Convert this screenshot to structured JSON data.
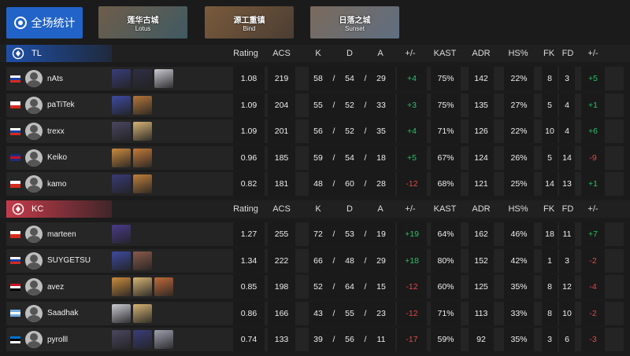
{
  "header": {
    "all_stats_label": "全场统计",
    "maps": [
      {
        "cn": "莲华古城",
        "en": "Lotus",
        "color_a": "#6f5d4a",
        "color_b": "#3f5a63"
      },
      {
        "cn": "源工重镇",
        "en": "Bind",
        "color_a": "#7a5b3c",
        "color_b": "#4b3d33"
      },
      {
        "cn": "日落之城",
        "en": "Sunset",
        "color_a": "#7a6a5c",
        "color_b": "#5f6e82"
      }
    ]
  },
  "columns": [
    "Rating",
    "ACS",
    "K",
    "D",
    "A",
    "+/-",
    "KAST",
    "ADR",
    "HS%",
    "FK",
    "FD",
    "+/-"
  ],
  "teams": [
    {
      "name": "TL",
      "accent": "#1e4fa8",
      "players": [
        {
          "name": "nAts",
          "flag": "ru",
          "agents": [
            "#3a3d7a",
            "#2f2f44",
            "#c9c9d3"
          ],
          "rating": "1.08",
          "acs": "219",
          "k": "58",
          "d": "54",
          "a": "29",
          "pm": "+4",
          "kast": "75%",
          "adr": "142",
          "hs": "22%",
          "fk": "8",
          "fd": "3",
          "fpm": "+5"
        },
        {
          "name": "paTiTek",
          "flag": "pl",
          "agents": [
            "#3e4aa0",
            "#b5773a"
          ],
          "rating": "1.09",
          "acs": "204",
          "k": "55",
          "d": "52",
          "a": "33",
          "pm": "+3",
          "kast": "75%",
          "adr": "135",
          "hs": "27%",
          "fk": "5",
          "fd": "4",
          "fpm": "+1"
        },
        {
          "name": "trexx",
          "flag": "ru",
          "agents": [
            "#4a4660",
            "#d6b374"
          ],
          "rating": "1.09",
          "acs": "201",
          "k": "56",
          "d": "52",
          "a": "35",
          "pm": "+4",
          "kast": "71%",
          "adr": "126",
          "hs": "22%",
          "fk": "10",
          "fd": "4",
          "fpm": "+6"
        },
        {
          "name": "Keiko",
          "flag": "gb",
          "agents": [
            "#c98a3e",
            "#c47a3a"
          ],
          "rating": "0.96",
          "acs": "185",
          "k": "59",
          "d": "54",
          "a": "18",
          "pm": "+5",
          "kast": "67%",
          "adr": "124",
          "hs": "26%",
          "fk": "5",
          "fd": "14",
          "fpm": "-9"
        },
        {
          "name": "kamo",
          "flag": "pl",
          "agents": [
            "#3a3a78",
            "#c07f3a"
          ],
          "rating": "0.82",
          "acs": "181",
          "k": "48",
          "d": "60",
          "a": "28",
          "pm": "-12",
          "kast": "68%",
          "adr": "121",
          "hs": "25%",
          "fk": "14",
          "fd": "13",
          "fpm": "+1"
        }
      ]
    },
    {
      "name": "KC",
      "accent": "#c43b4a",
      "players": [
        {
          "name": "marteen",
          "flag": "cz",
          "agents": [
            "#4a3a8a"
          ],
          "rating": "1.27",
          "acs": "255",
          "k": "72",
          "d": "53",
          "a": "19",
          "pm": "+19",
          "kast": "64%",
          "adr": "162",
          "hs": "46%",
          "fk": "18",
          "fd": "11",
          "fpm": "+7"
        },
        {
          "name": "SUYGETSU",
          "flag": "ru",
          "agents": [
            "#3e4aa0",
            "#8a5a4a"
          ],
          "rating": "1.34",
          "acs": "222",
          "k": "66",
          "d": "48",
          "a": "29",
          "pm": "+18",
          "kast": "80%",
          "adr": "152",
          "hs": "42%",
          "fk": "1",
          "fd": "3",
          "fpm": "-2"
        },
        {
          "name": "avez",
          "flag": "eg",
          "agents": [
            "#c98a3e",
            "#d6b374",
            "#c06a3a"
          ],
          "rating": "0.85",
          "acs": "198",
          "k": "52",
          "d": "64",
          "a": "15",
          "pm": "-12",
          "kast": "60%",
          "adr": "125",
          "hs": "35%",
          "fk": "8",
          "fd": "12",
          "fpm": "-4"
        },
        {
          "name": "Saadhak",
          "flag": "ar",
          "agents": [
            "#c9c9d3",
            "#d6b374"
          ],
          "rating": "0.86",
          "acs": "166",
          "k": "43",
          "d": "55",
          "a": "23",
          "pm": "-12",
          "kast": "71%",
          "adr": "113",
          "hs": "33%",
          "fk": "8",
          "fd": "10",
          "fpm": "-2"
        },
        {
          "name": "pyrolll",
          "flag": "ee",
          "agents": [
            "#4a4660",
            "#3a3d7a",
            "#9ea0b0"
          ],
          "rating": "0.74",
          "acs": "133",
          "k": "39",
          "d": "56",
          "a": "11",
          "pm": "-17",
          "kast": "59%",
          "adr": "92",
          "hs": "35%",
          "fk": "3",
          "fd": "6",
          "fpm": "-3"
        }
      ]
    }
  ]
}
